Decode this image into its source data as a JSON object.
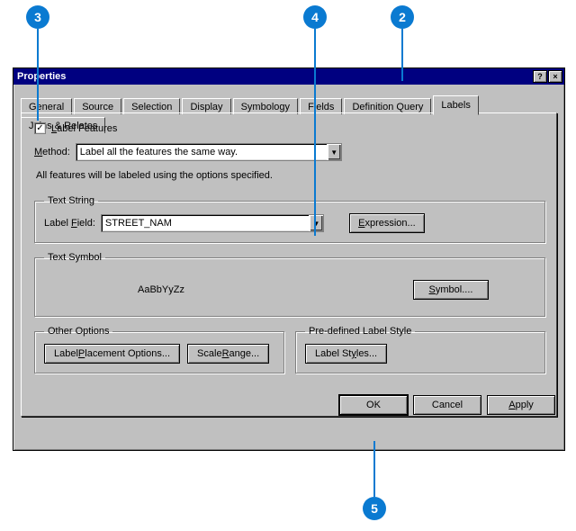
{
  "callouts": {
    "c2": "2",
    "c3": "3",
    "c4": "4",
    "c5": "5"
  },
  "window": {
    "title": "Properties",
    "help": "?",
    "close": "×"
  },
  "tabs": {
    "general": "General",
    "source": "Source",
    "selection": "Selection",
    "display": "Display",
    "symbology": "Symbology",
    "fields": "Fields",
    "defquery": "Definition Query",
    "labels": "Labels",
    "joins": "Joins & Relates"
  },
  "labelsTab": {
    "label_features_prefix": "L",
    "label_features_rest": "abel Features",
    "method_prefix": "M",
    "method_rest": "ethod:",
    "method_value": "Label all the features the same way.",
    "info": "All features will be labeled using the options specified.",
    "text_string_legend": "Text String",
    "label_field_pre": "Label ",
    "label_field_u": "F",
    "label_field_post": "ield:",
    "label_field_value": "STREET_NAM",
    "expression_u": "E",
    "expression_rest": "xpression...",
    "text_symbol_legend": "Text Symbol",
    "sample_text": "AaBbYyZz",
    "symbol_u": "S",
    "symbol_rest": "ymbol....",
    "other_options_legend": "Other Options",
    "placement_pre": "Label ",
    "placement_u": "P",
    "placement_post": "lacement Options...",
    "scale_pre": "Scale ",
    "scale_u": "R",
    "scale_post": "ange...",
    "predef_legend": "Pre-defined Label Style",
    "labelstyles_pre": "Label St",
    "labelstyles_u": "y",
    "labelstyles_post": "les..."
  },
  "buttons": {
    "ok": "OK",
    "cancel": "Cancel",
    "apply_u": "A",
    "apply_rest": "pply"
  }
}
